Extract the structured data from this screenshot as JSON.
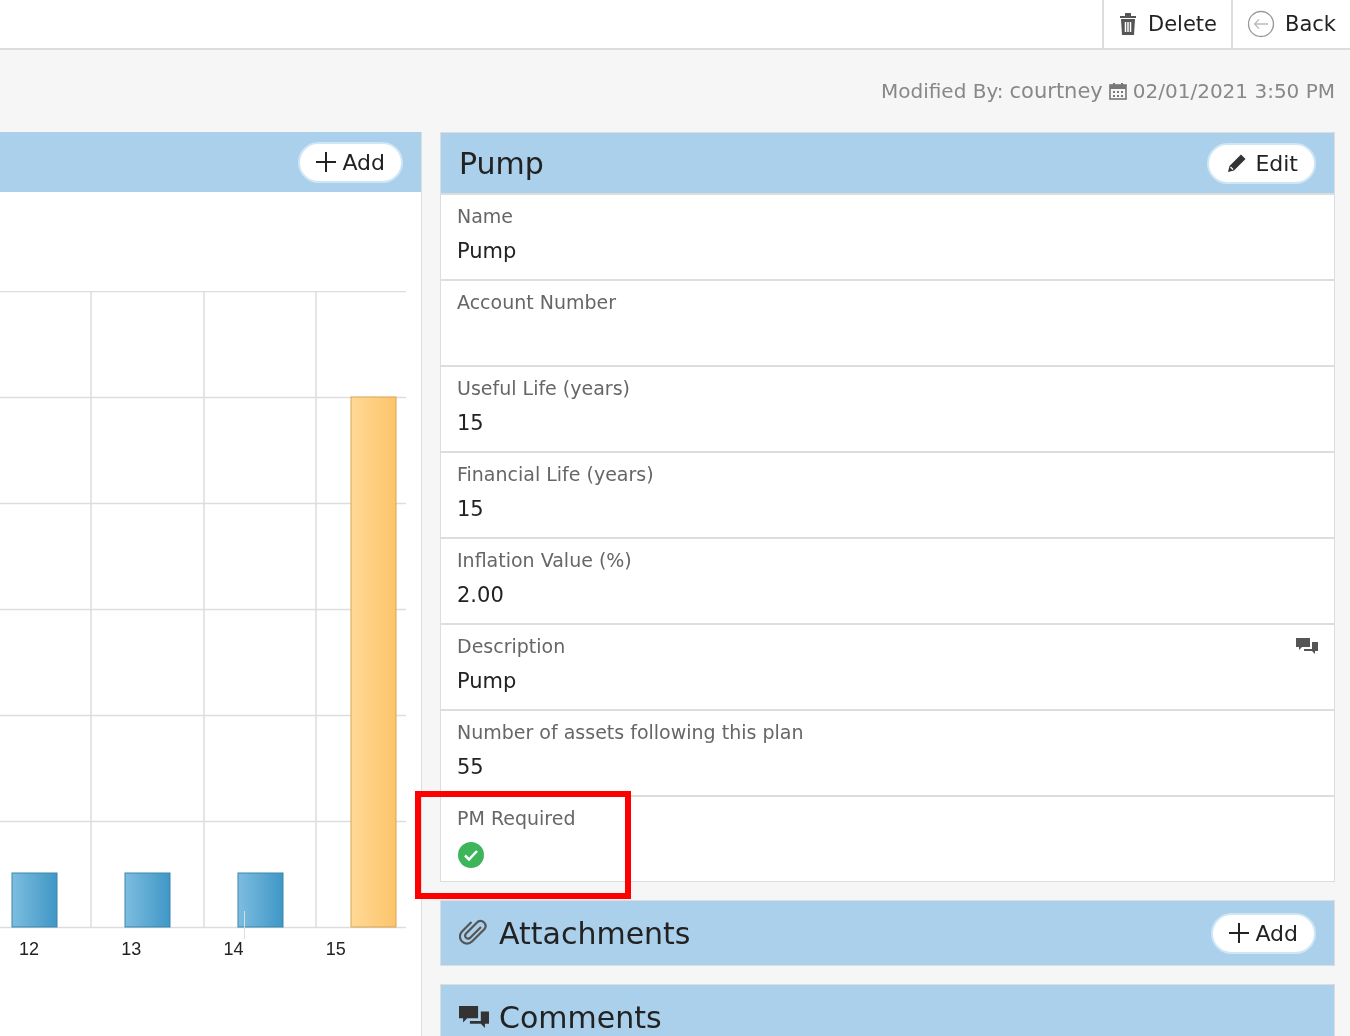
{
  "toolbar": {
    "buttons": [
      {
        "kind": "delete",
        "label": "Delete"
      },
      {
        "kind": "back",
        "label": "Back"
      }
    ]
  },
  "modified": {
    "label": "Modified By:",
    "user": "courtney",
    "timestamp": "02/01/2021 3:50 PM"
  },
  "chart_panel": {
    "add_button": "Add",
    "x_labels": [
      "12",
      "13",
      "14",
      "15"
    ],
    "bars": [
      {
        "selected": false
      },
      {
        "selected": false
      },
      {
        "selected": false
      },
      {
        "selected": true
      }
    ]
  },
  "details": {
    "title": "Pump",
    "edit_button": "Edit",
    "fields": [
      {
        "kind": "text",
        "label": "Name",
        "value": "Pump",
        "highlighted": false
      },
      {
        "kind": "text",
        "label": "Account Number",
        "highlighted": false
      },
      {
        "kind": "text",
        "label": "Useful Life (years)",
        "value": "15",
        "highlighted": false
      },
      {
        "kind": "text",
        "label": "Financial Life (years)",
        "value": "15",
        "highlighted": false
      },
      {
        "kind": "text",
        "label": "Inflation Value (%)",
        "value": "2.00",
        "highlighted": false
      },
      {
        "kind": "note",
        "label": "Description",
        "value": "Pump",
        "highlighted": false
      },
      {
        "kind": "text",
        "label": "Number of assets following this plan",
        "value": "55",
        "highlighted": false
      },
      {
        "kind": "check",
        "label": "PM Required",
        "checked": true,
        "highlighted": true
      }
    ]
  },
  "attachments": {
    "title": "Attachments",
    "add_button": "Add"
  },
  "comments": {
    "title": "Comments"
  }
}
